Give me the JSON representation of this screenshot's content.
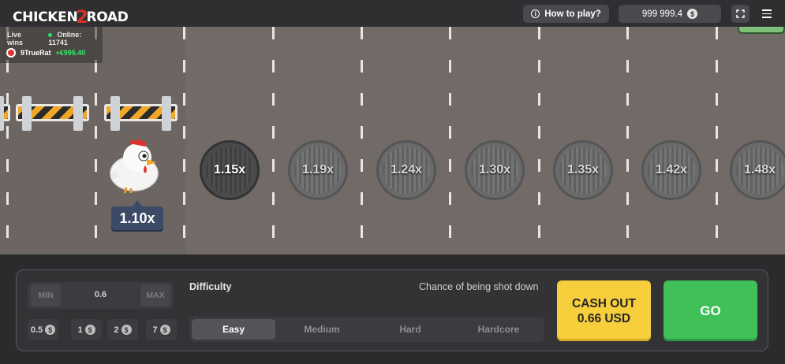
{
  "header": {
    "logo_left": "CHICKEN",
    "logo_mid": "2",
    "logo_right": "ROAD",
    "how_to_play": "How to play?",
    "balance": "999 999.4",
    "currency_symbol": "$"
  },
  "live": {
    "live_wins": "Live wins",
    "online_label": "Online: 11741",
    "player": "9TrueRat",
    "amount": "+€995.40"
  },
  "road": {
    "multipliers": [
      "1.15x",
      "1.19x",
      "1.24x",
      "1.30x",
      "1.35x",
      "1.42x",
      "1.48x"
    ],
    "current_multiplier": "1.10x"
  },
  "controls": {
    "min": "MIN",
    "max": "MAX",
    "bet_value": "0.6",
    "chips": [
      "0.5",
      "1",
      "2",
      "7"
    ],
    "difficulty_label": "Difficulty",
    "chance_label": "Chance of being shot down",
    "difficulties": [
      "Easy",
      "Medium",
      "Hard",
      "Hardcore"
    ],
    "selected_difficulty": "Easy",
    "cashout_line1": "CASH OUT",
    "cashout_line2": "0.66 USD",
    "go": "GO"
  },
  "colors": {
    "go_green": "#3fc058",
    "cashout_yellow": "#f7ce3c",
    "road_gray": "#716a66",
    "win_green": "#3ce86b"
  }
}
